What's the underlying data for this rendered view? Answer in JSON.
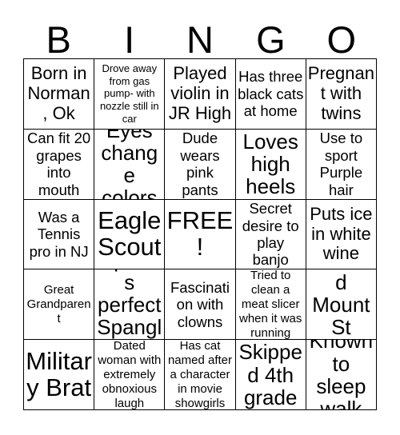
{
  "card": {
    "type": "bingo-card",
    "header_letters": [
      "B",
      "I",
      "N",
      "G",
      "O"
    ],
    "grid_size": "5x5",
    "colors": {
      "background": "#ffffff",
      "text": "#000000",
      "border": "#000000"
    },
    "rows": [
      [
        {
          "text": "Born in Norman, Ok",
          "size": "lg"
        },
        {
          "text": "Drove away from gas pump- with nozzle still in car",
          "size": "xs"
        },
        {
          "text": "Played violin in JR High",
          "size": "lg"
        },
        {
          "text": "Has three black cats at home",
          "size": "md"
        },
        {
          "text": "Pregnant with twins",
          "size": "lg"
        }
      ],
      [
        {
          "text": "Can fit 20 grapes into mouth",
          "size": "md"
        },
        {
          "text": "Eyes change colors",
          "size": "xl"
        },
        {
          "text": "Dude wears pink pants",
          "size": "md"
        },
        {
          "text": "Loves high heels",
          "size": "xl"
        },
        {
          "text": "Use to sport Purple hair",
          "size": "md"
        }
      ],
      [
        {
          "text": "Was a Tennis pro in NJ",
          "size": "md"
        },
        {
          "text": "Eagle Scout",
          "size": "xxl"
        },
        {
          "text": "FREE!",
          "size": "xxl"
        },
        {
          "text": "Secret desire to play banjo",
          "size": "md"
        },
        {
          "text": "Puts ice in white wine",
          "size": "lg"
        }
      ],
      [
        {
          "text": "Great Grandparent",
          "size": "sm"
        },
        {
          "text": "Speaks perfect Spanglish",
          "size": "xl"
        },
        {
          "text": "Fascination with clowns",
          "size": "md"
        },
        {
          "text": "Tried to clean a meat slicer when it was running",
          "size": "sm"
        },
        {
          "text": "Climbed Mount St Helens",
          "size": "xl"
        }
      ],
      [
        {
          "text": "Military Brat",
          "size": "xxl"
        },
        {
          "text": "Dated woman with extremely obnoxious laugh",
          "size": "sm"
        },
        {
          "text": "Has cat named after a character in movie showgirls",
          "size": "sm"
        },
        {
          "text": "Skipped 4th grade",
          "size": "xl"
        },
        {
          "text": "Known to sleep walk",
          "size": "xl"
        }
      ]
    ]
  }
}
